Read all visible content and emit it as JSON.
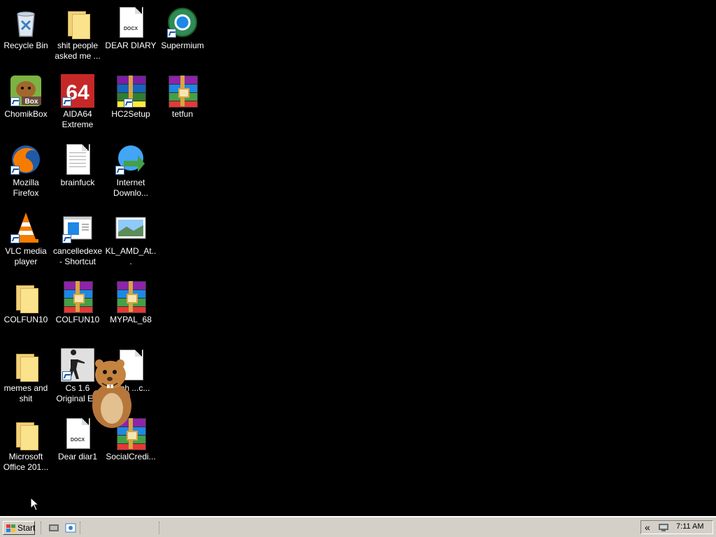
{
  "desktop": {
    "icons": [
      {
        "label": "Recycle Bin"
      },
      {
        "label": "shit people asked me ..."
      },
      {
        "label": "DEAR DIARY",
        "tag": "DOCX"
      },
      {
        "label": "Supermium"
      },
      {
        "label": "ChomikBox",
        "art_text": "Box"
      },
      {
        "label": "AIDA64 Extreme",
        "art_text": "64"
      },
      {
        "label": "HC2Setup"
      },
      {
        "label": "tetfun"
      },
      {
        "label": "Mozilla Firefox"
      },
      {
        "label": "brainfuck"
      },
      {
        "label": "Internet Downlo..."
      },
      {
        "label": "VLC media player"
      },
      {
        "label": "cancelledexe - Shortcut"
      },
      {
        "label": "KL_AMD_At..."
      },
      {
        "label": "COLFUN10"
      },
      {
        "label": "COLFUN10"
      },
      {
        "label": "MYPAL_68"
      },
      {
        "label": "memes and shit"
      },
      {
        "label": "Cs 1.6 Original EN"
      },
      {
        "label": "...ich ...c..."
      },
      {
        "label": "Microsoft Office 201..."
      },
      {
        "label": "Dear diar1",
        "tag": "DOCX"
      },
      {
        "label": "SocialCredi..."
      }
    ]
  },
  "taskbar": {
    "start_label": "Start",
    "tray_arrow": "«",
    "clock": "7:11 AM"
  }
}
